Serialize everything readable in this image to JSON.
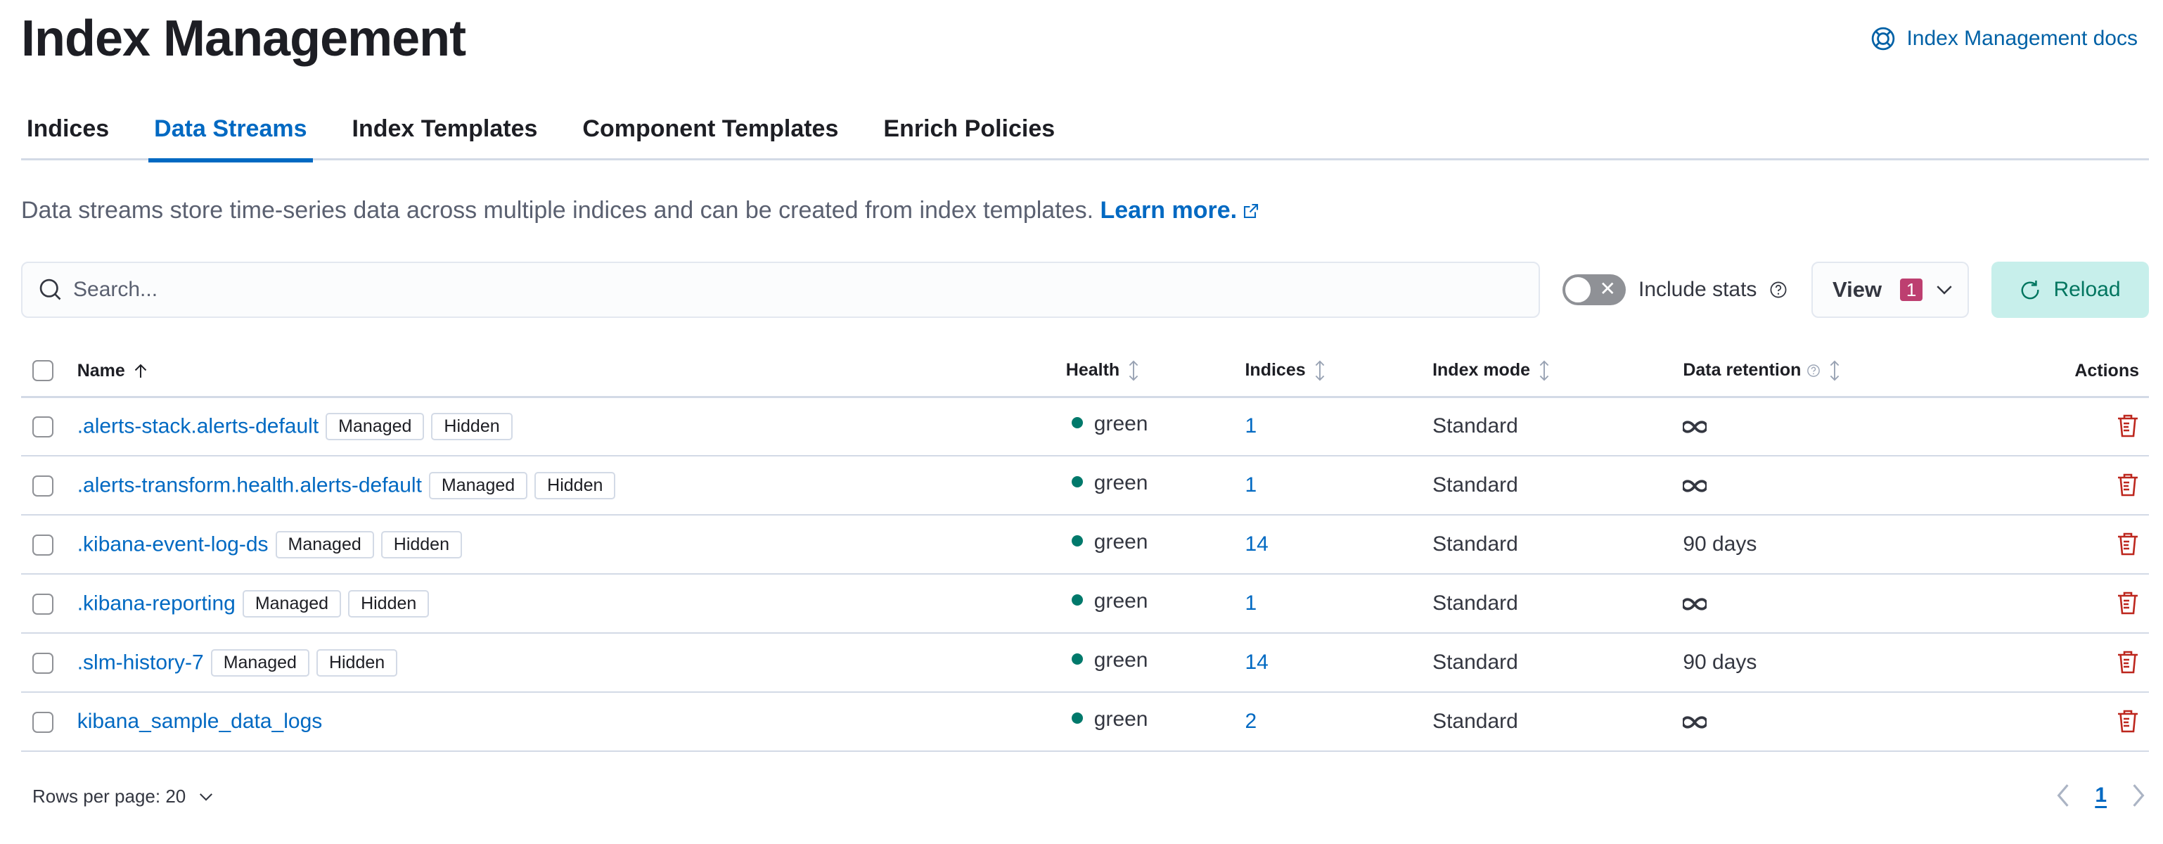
{
  "header": {
    "title": "Index Management",
    "docs_link": "Index Management docs"
  },
  "tabs": [
    {
      "label": "Indices",
      "active": false
    },
    {
      "label": "Data Streams",
      "active": true
    },
    {
      "label": "Index Templates",
      "active": false
    },
    {
      "label": "Component Templates",
      "active": false
    },
    {
      "label": "Enrich Policies",
      "active": false
    }
  ],
  "description": {
    "text": "Data streams store time-series data across multiple indices and can be created from index templates. ",
    "link": "Learn more."
  },
  "toolbar": {
    "search_placeholder": "Search...",
    "search_value": "",
    "include_stats_label": "Include stats",
    "include_stats_on": false,
    "view_label": "View",
    "view_badge": "1",
    "reload_label": "Reload"
  },
  "table": {
    "columns": {
      "name": "Name",
      "health": "Health",
      "indices": "Indices",
      "index_mode": "Index mode",
      "data_retention": "Data retention",
      "actions": "Actions"
    },
    "rows": [
      {
        "name": ".alerts-stack.alerts-default",
        "badges": [
          "Managed",
          "Hidden"
        ],
        "health": "green",
        "indices": "1",
        "index_mode": "Standard",
        "retention": "infinite"
      },
      {
        "name": ".alerts-transform.health.alerts-default",
        "badges": [
          "Managed",
          "Hidden"
        ],
        "health": "green",
        "indices": "1",
        "index_mode": "Standard",
        "retention": "infinite"
      },
      {
        "name": ".kibana-event-log-ds",
        "badges": [
          "Managed",
          "Hidden"
        ],
        "health": "green",
        "indices": "14",
        "index_mode": "Standard",
        "retention": "90 days"
      },
      {
        "name": ".kibana-reporting",
        "badges": [
          "Managed",
          "Hidden"
        ],
        "health": "green",
        "indices": "1",
        "index_mode": "Standard",
        "retention": "infinite"
      },
      {
        "name": ".slm-history-7",
        "badges": [
          "Managed",
          "Hidden"
        ],
        "health": "green",
        "indices": "14",
        "index_mode": "Standard",
        "retention": "90 days"
      },
      {
        "name": "kibana_sample_data_logs",
        "badges": [],
        "health": "green",
        "indices": "2",
        "index_mode": "Standard",
        "retention": "infinite"
      }
    ]
  },
  "footer": {
    "rows_per_page_label": "Rows per page: 20",
    "current_page": "1"
  },
  "colors": {
    "link": "#0069c2",
    "health_green": "#00796b",
    "danger": "#bd271e",
    "reload_bg": "#c7efeb",
    "view_badge": "#bd3f70"
  }
}
